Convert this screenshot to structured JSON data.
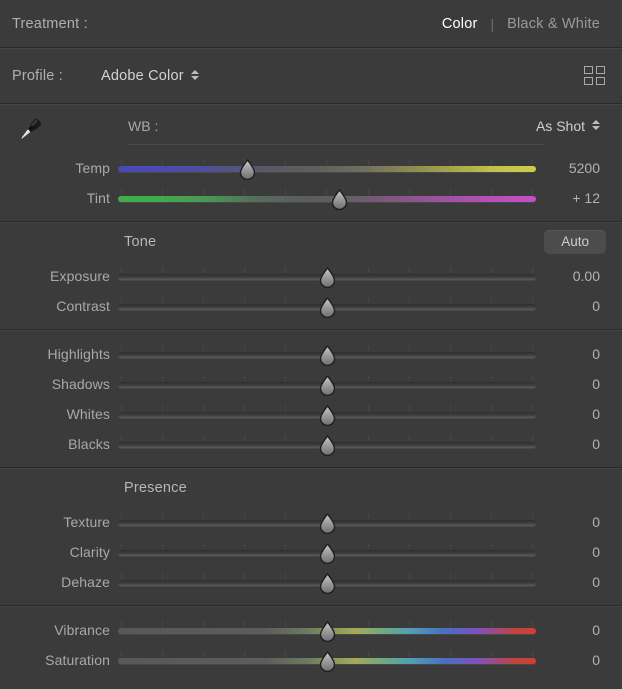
{
  "treatment": {
    "label": "Treatment :",
    "options": [
      "Color",
      "Black & White"
    ],
    "separator": "|",
    "selected": "Color"
  },
  "profile": {
    "label": "Profile :",
    "value": "Adobe Color",
    "browse_icon": "grid-icon"
  },
  "white_balance": {
    "eyedropper_icon": "eyedropper-icon",
    "label": "WB :",
    "value": "As Shot",
    "sliders": [
      {
        "name": "Temp",
        "value": "5200",
        "position": 31,
        "gradient": "temp"
      },
      {
        "name": "Tint",
        "value": "+ 12",
        "position": 53,
        "gradient": "tint"
      }
    ]
  },
  "tone": {
    "title": "Tone",
    "auto_label": "Auto",
    "sliders": [
      {
        "name": "Exposure",
        "value": "0.00",
        "position": 50,
        "gradient": "none"
      },
      {
        "name": "Contrast",
        "value": "0",
        "position": 50,
        "gradient": "none"
      }
    ]
  },
  "tone_detail": {
    "sliders": [
      {
        "name": "Highlights",
        "value": "0",
        "position": 50,
        "gradient": "none"
      },
      {
        "name": "Shadows",
        "value": "0",
        "position": 50,
        "gradient": "none"
      },
      {
        "name": "Whites",
        "value": "0",
        "position": 50,
        "gradient": "none"
      },
      {
        "name": "Blacks",
        "value": "0",
        "position": 50,
        "gradient": "none"
      }
    ]
  },
  "presence": {
    "title": "Presence",
    "sliders": [
      {
        "name": "Texture",
        "value": "0",
        "position": 50,
        "gradient": "none"
      },
      {
        "name": "Clarity",
        "value": "0",
        "position": 50,
        "gradient": "none"
      },
      {
        "name": "Dehaze",
        "value": "0",
        "position": 50,
        "gradient": "none"
      }
    ]
  },
  "color_mix": {
    "sliders": [
      {
        "name": "Vibrance",
        "value": "0",
        "position": 50,
        "gradient": "vib"
      },
      {
        "name": "Saturation",
        "value": "0",
        "position": 50,
        "gradient": "vib"
      }
    ]
  },
  "colors": {
    "panel_bg": "#3b3b3b",
    "text": "#b0b0b0",
    "active_text": "#ffffff",
    "divider_dark": "#2a2a2a",
    "divider_light": "#454545",
    "auto_button_bg": "#4c4c4c"
  }
}
